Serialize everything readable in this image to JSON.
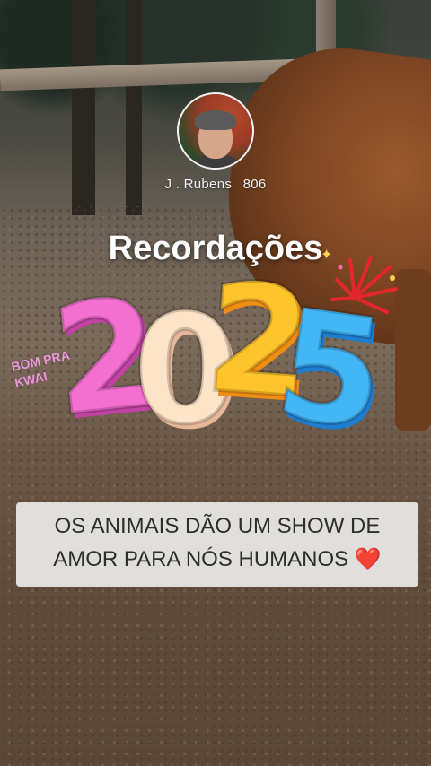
{
  "profile": {
    "name": "J . Rubens",
    "count": "806"
  },
  "overlay": {
    "title": "Recordações",
    "year_digits": [
      "2",
      "0",
      "2",
      "5"
    ],
    "watermark_line1": "BOM PRA",
    "watermark_line2": "KWAI"
  },
  "caption": {
    "line1": "OS ANIMAIS DÃO UM SHOW DE",
    "line2": "AMOR PARA NÓS HUMANOS",
    "emoji": "❤️"
  }
}
